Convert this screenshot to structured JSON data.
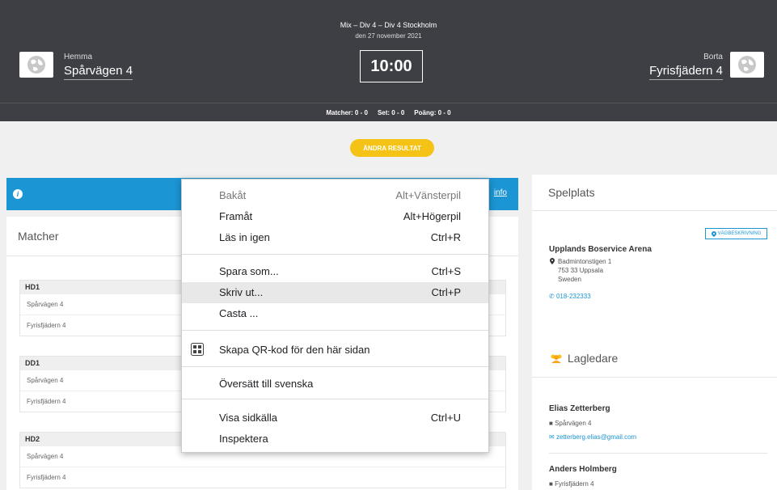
{
  "header": {
    "division": "Mix – Div 4 – Div 4 Stockholm",
    "date": "den 27 november 2021",
    "home_caption": "Hemma",
    "home_team": "Spårvägen 4",
    "away_caption": "Borta",
    "away_team": "Fyrisfjädern 4",
    "time": "10:00",
    "score_matches": "Matcher: 0 - 0",
    "score_sets": "Set: 0 - 0",
    "score_points": "Poäng: 0 - 0"
  },
  "change_button": "ÄNDRA RESULTAT",
  "info_link": "info",
  "matches": {
    "title": "Matcher",
    "items": [
      {
        "name": "HD1",
        "home": "Spårvägen 4",
        "away": "Fyrisfjädern 4"
      },
      {
        "name": "DD1",
        "home": "Spårvägen 4",
        "away": "Fyrisfjädern 4"
      },
      {
        "name": "HD2",
        "home": "Spårvägen 4",
        "away": "Fyrisfjädern 4"
      }
    ]
  },
  "venue": {
    "title": "Spelplats",
    "route_button": "VÄGBESKRIVNING",
    "name": "Upplands Boservice Arena",
    "street": "Badmintonstigen 1",
    "postal": "753 33 Uppsala",
    "country": "Sweden",
    "phone": "018-232333"
  },
  "leaders": {
    "title": "Lagledare",
    "items": [
      {
        "name": "Elias Zetterberg",
        "team": "Spårvägen 4",
        "email": "zetterberg.elias@gmail.com"
      },
      {
        "name": "Anders Holmberg",
        "team": "Fyrisfjädern 4"
      }
    ]
  },
  "context_menu": {
    "back": {
      "label": "Bakåt",
      "shortcut": "Alt+Vänsterpil"
    },
    "forward": {
      "label": "Framåt",
      "shortcut": "Alt+Högerpil"
    },
    "reload": {
      "label": "Läs in igen",
      "shortcut": "Ctrl+R"
    },
    "save_as": {
      "label": "Spara som...",
      "shortcut": "Ctrl+S"
    },
    "print": {
      "label": "Skriv ut...",
      "shortcut": "Ctrl+P"
    },
    "cast": {
      "label": "Casta ..."
    },
    "qr": {
      "label": "Skapa QR-kod för den här sidan"
    },
    "translate": {
      "label": "Översätt till svenska"
    },
    "view_source": {
      "label": "Visa sidkälla",
      "shortcut": "Ctrl+U"
    },
    "inspect": {
      "label": "Inspektera"
    }
  },
  "colors": {
    "header_bg": "#3e3f45",
    "accent_blue": "#1c95d4",
    "accent_yellow": "#f5c315"
  }
}
